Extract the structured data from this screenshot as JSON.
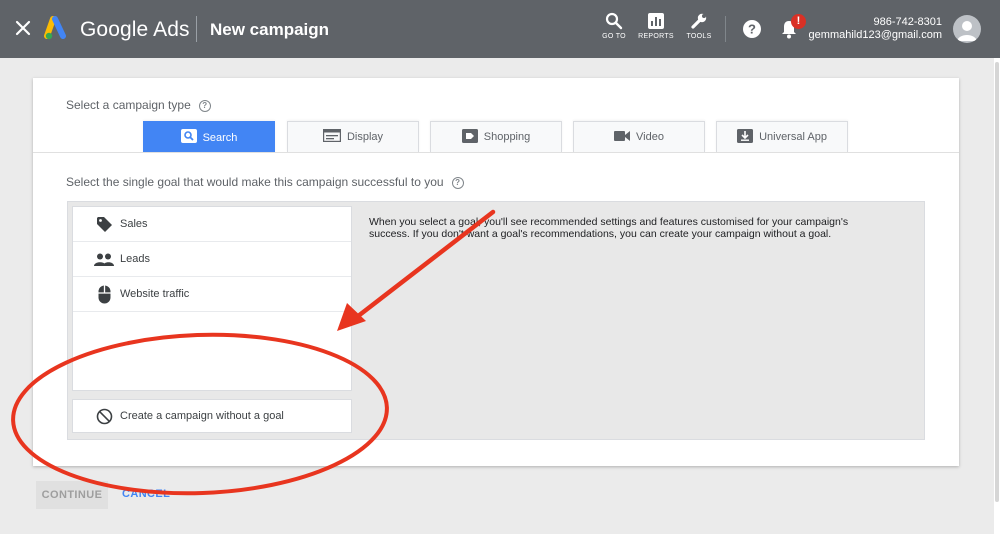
{
  "header": {
    "brand": "Google Ads",
    "page_title": "New campaign",
    "nav": [
      {
        "label": "GO TO",
        "icon": "search-icon"
      },
      {
        "label": "REPORTS",
        "icon": "reports-icon"
      },
      {
        "label": "TOOLS",
        "icon": "wrench-icon"
      }
    ],
    "notification_badge": "!",
    "account": {
      "phone": "986-742-8301",
      "email": "gemmahild123@gmail.com"
    }
  },
  "campaign_type": {
    "label": "Select a campaign type",
    "tabs": [
      {
        "label": "Search",
        "icon": "search-icon",
        "active": true
      },
      {
        "label": "Display",
        "icon": "display-icon",
        "active": false
      },
      {
        "label": "Shopping",
        "icon": "shopping-tag-icon",
        "active": false
      },
      {
        "label": "Video",
        "icon": "video-icon",
        "active": false
      },
      {
        "label": "Universal App",
        "icon": "download-icon",
        "active": false
      }
    ]
  },
  "goal": {
    "label": "Select the single goal that would make this campaign successful to you",
    "items": [
      {
        "label": "Sales",
        "icon": "tag-icon"
      },
      {
        "label": "Leads",
        "icon": "people-icon"
      },
      {
        "label": "Website traffic",
        "icon": "mouse-icon"
      }
    ],
    "no_goal_label": "Create a campaign without a goal",
    "info_text": "When you select a goal, you'll see recommended settings and features customised for your campaign's success. If you don't want a goal's recommendations, you can create your campaign without a goal."
  },
  "actions": {
    "continue_label": "CONTINUE",
    "cancel_label": "CANCEL"
  },
  "colors": {
    "header_bg": "#5f6368",
    "accent": "#4285f4",
    "annotation": "#e8351f",
    "badge": "#d93025"
  }
}
